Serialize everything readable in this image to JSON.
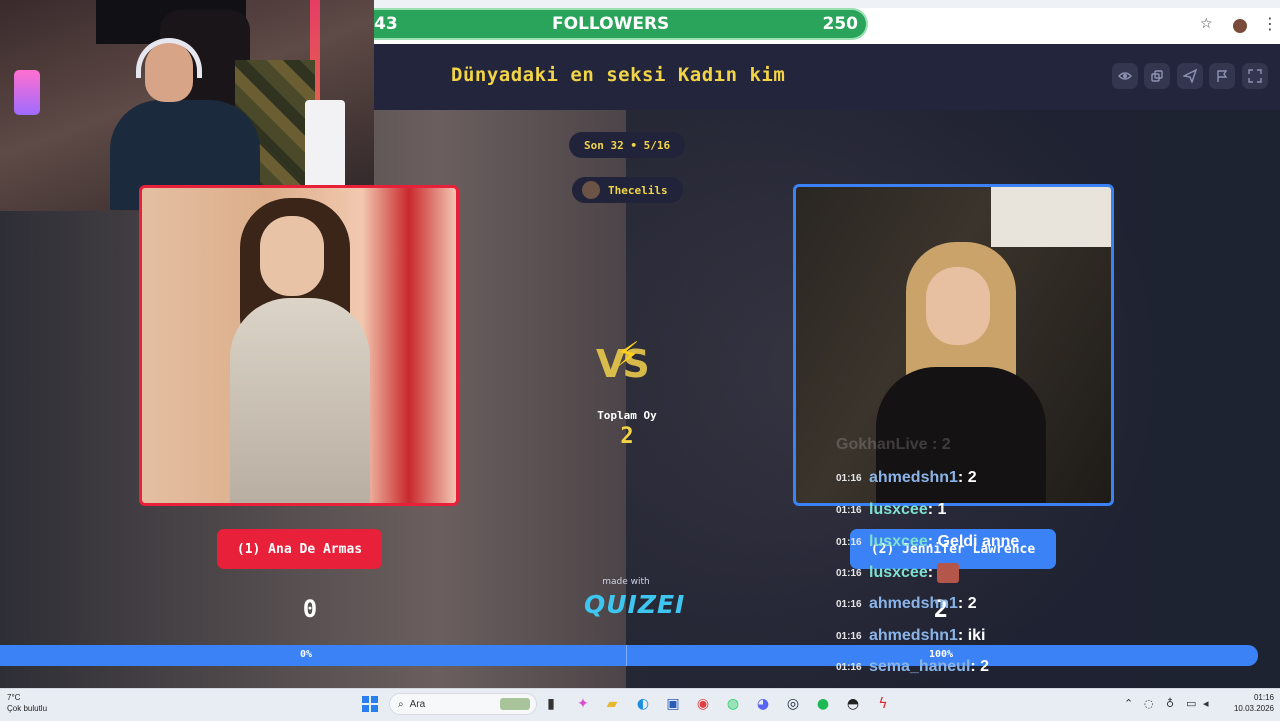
{
  "stream": {
    "followers_goal": {
      "current": "43",
      "label": "FOLLOWERS",
      "target": "250"
    }
  },
  "quiz": {
    "title": "Dünyadaki en seksi Kadın kim",
    "round": "Son 32 • 5/16",
    "player": "Thecelils",
    "total_votes_label": "Toplam Oy",
    "total_votes": "2",
    "vs_label": "VS",
    "left": {
      "name": "(1) Ana De Armas",
      "votes": "0",
      "percent": "0%",
      "color": "#e8203a"
    },
    "right": {
      "name": "(2) Jennifer Lawrence",
      "votes": "2",
      "percent": "100%",
      "color": "#3b82f6"
    },
    "made_with": "made with",
    "brand": "QUIZEI",
    "toolbar": [
      "eye-icon",
      "share-icon",
      "send-icon",
      "flag-icon",
      "fullscreen-icon"
    ]
  },
  "chat": {
    "ghost": "GokhanLive : 2",
    "messages": [
      {
        "time": "01:16",
        "user": "ahmedshn1",
        "text": ": 2",
        "color": "#8ab4e8"
      },
      {
        "time": "01:16",
        "user": "lusxcee",
        "text": ": 1",
        "color": "#7ee0d0"
      },
      {
        "time": "01:16",
        "user": "lusxcee",
        "text": ": Geldi anne",
        "color": "#7ee0d0"
      },
      {
        "time": "01:16",
        "user": "lusxcee",
        "text": ":",
        "color": "#7ee0d0",
        "emote": true
      },
      {
        "time": "01:16",
        "user": "ahmedshn1",
        "text": ": 2",
        "color": "#8ab4e8"
      },
      {
        "time": "01:16",
        "user": "ahmedshn1",
        "text": ": iki",
        "color": "#8ab4e8"
      },
      {
        "time": "01:16",
        "user": "sema_haneul",
        "text": ": 2",
        "color": "#8ab4e8"
      }
    ]
  },
  "taskbar": {
    "weather_temp": "7°C",
    "weather_desc": "Çok bulutlu",
    "search_placeholder": "Ara",
    "time": "01:16",
    "date": "10.03.2026"
  }
}
